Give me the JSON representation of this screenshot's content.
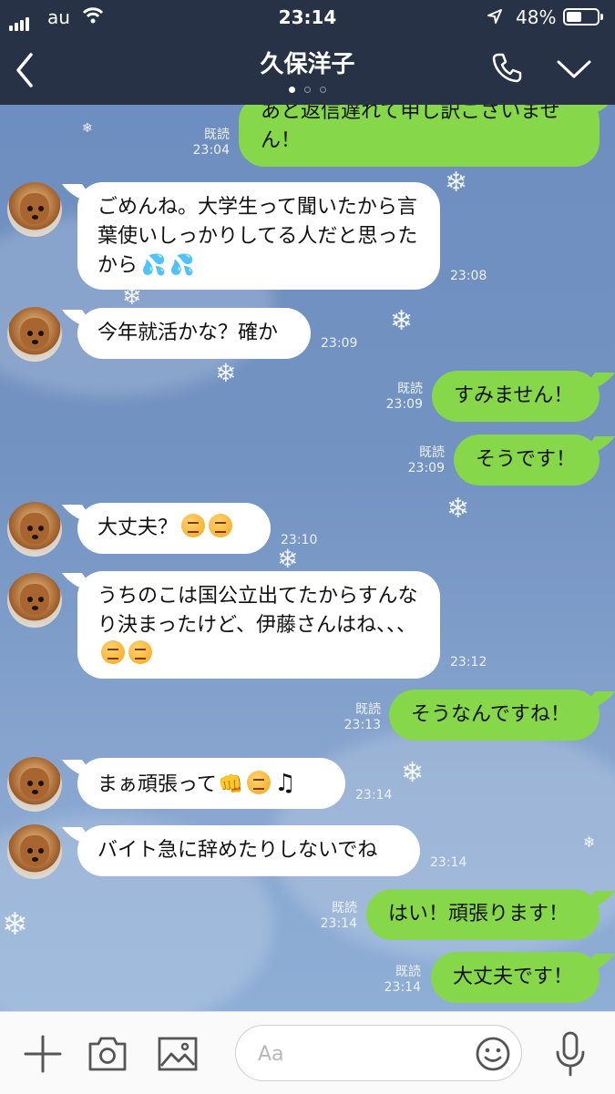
{
  "status_bar": {
    "carrier": "au",
    "time": "23:14",
    "battery": "48%"
  },
  "header": {
    "title": "久保洋子"
  },
  "messages": [
    {
      "side": "out",
      "text": "あと返信遅れて申し訳ございません！",
      "read": "既読",
      "time": "23:04"
    },
    {
      "side": "in",
      "text": "ごめんね。大学生って聞いたから言葉使いしっかりしてる人だと思ったから",
      "time": "23:08"
    },
    {
      "side": "in",
      "text": "今年就活かな？確か",
      "time": "23:09"
    },
    {
      "side": "out",
      "text": "すみません！",
      "read": "既読",
      "time": "23:09"
    },
    {
      "side": "out",
      "text": "そうです！",
      "read": "既読",
      "time": "23:09"
    },
    {
      "side": "in",
      "text": "大丈夫？",
      "time": "23:10"
    },
    {
      "side": "in",
      "text": "うちのこは国公立出てたからすんなり決まったけど、伊藤さんはね、、、",
      "time": "23:12"
    },
    {
      "side": "out",
      "text": "そうなんですね！",
      "read": "既読",
      "time": "23:13"
    },
    {
      "side": "in",
      "text": "まぁ頑張って",
      "time": "23:14"
    },
    {
      "side": "in",
      "text": "バイト急に辞めたりしないでね",
      "time": "23:14"
    },
    {
      "side": "out",
      "text": "はい！頑張ります！",
      "read": "既読",
      "time": "23:14"
    },
    {
      "side": "out",
      "text": "大丈夫です！",
      "read": "既読",
      "time": "23:14"
    }
  ],
  "input": {
    "placeholder": "Aa"
  },
  "colors": {
    "header_bg": "#273246",
    "out_bubble": "#86d74a",
    "in_bubble": "#ffffff",
    "chat_bg": "#6f8fbd"
  },
  "icons": [
    "back-chevron-icon",
    "phone-icon",
    "chevron-down-icon",
    "plus-icon",
    "camera-icon",
    "image-icon",
    "emoji-icon",
    "microphone-icon"
  ]
}
